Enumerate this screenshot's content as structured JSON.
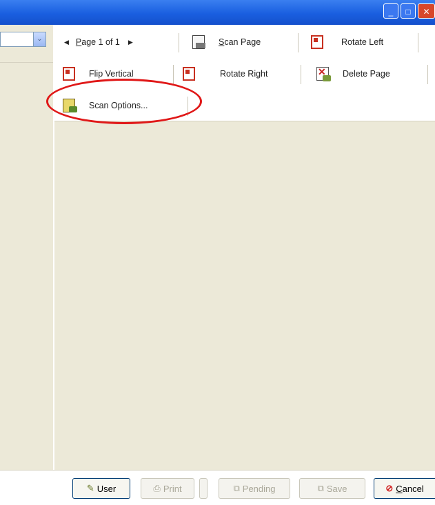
{
  "window": {
    "controls": {
      "minimize": "_",
      "maximize": "□",
      "close": "✕"
    },
    "title_color": "#1a5fe0"
  },
  "left": {
    "combo_arrow": "⌄"
  },
  "toolbar": {
    "pager": {
      "prev": "◀",
      "label_prefix": "P",
      "label_rest": "age 1 of 1",
      "next": "▶"
    },
    "scan_page": {
      "accel": "S",
      "rest": "can Page",
      "icon": "scanner-icon"
    },
    "rotate_left": {
      "label": "Rotate Left",
      "icon": "rotate-left-icon"
    },
    "flip_vertical": {
      "label": "Flip Vertical",
      "icon": "flip-vertical-icon"
    },
    "rotate_right": {
      "label": "Rotate Right",
      "icon": "rotate-right-icon"
    },
    "delete_page": {
      "label": "Delete Page",
      "icon": "delete-page-icon"
    },
    "scan_options": {
      "label": "Scan Options...",
      "icon": "scan-options-icon"
    }
  },
  "bottom": {
    "user": {
      "label": "User",
      "icon": "user-icon",
      "enabled": true
    },
    "print": {
      "label": "Print",
      "icon": "printer-icon",
      "enabled": false
    },
    "pending": {
      "label": "Pending",
      "icon": "pending-icon",
      "enabled": false
    },
    "save": {
      "label": "Save",
      "icon": "save-icon",
      "enabled": false
    },
    "cancel": {
      "accel": "C",
      "rest": "ancel",
      "icon": "cancel-icon",
      "enabled": true
    }
  },
  "annotation": {
    "color": "#e01818",
    "target": "scan-options-button"
  }
}
